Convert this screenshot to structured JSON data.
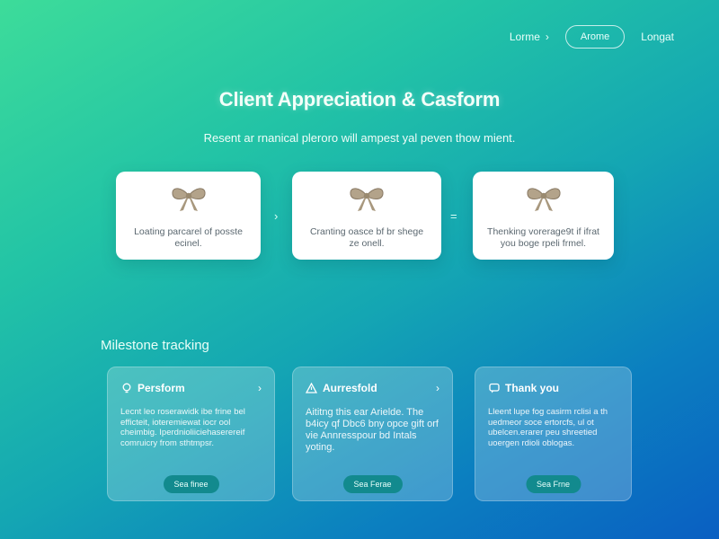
{
  "nav": {
    "link1": "Lorme",
    "link1_chevron": "›",
    "pill": "Arome",
    "link2": "Longat"
  },
  "hero": {
    "title": "Client Appreciation & Casform",
    "subtitle": "Resent ar rnanical pleroro will ampest yal peven thow mient."
  },
  "steps": [
    {
      "text": "Loating parcarel of posste ecinel."
    },
    {
      "text": "Cranting oasce bf br shege ze onell."
    },
    {
      "text": "Thenking vorerage9t if ifrat you boge rpeli frmel."
    }
  ],
  "separators": [
    "›",
    "="
  ],
  "milestone": {
    "title": "Milestone tracking",
    "cards": [
      {
        "title": "Persform",
        "chevron": "›",
        "body": "Lecnt leo roserawidk ibe frine bel efficteit, ioteremiewat iocr ool cheimbig. Iperdnioliiciehaserereif comruicry from sthtmpsr.",
        "button": "Sea finee"
      },
      {
        "title": "Aurresfold",
        "chevron": "›",
        "body": "Aititng this ear Arielde. The b4icy qf Dbc6 bny opce gift orf vie Annresspour bd Intals yoting.",
        "button": "Sea Ferae"
      },
      {
        "title": "Thank you",
        "chevron": "",
        "body": "Lleent lupe fog casirm rclisi a th uedmeor soce ertorcfs, ul ot ubelcen.erarer peu shreetied uoergen rdioli oblogas.",
        "button": "Sea Frne"
      }
    ]
  }
}
